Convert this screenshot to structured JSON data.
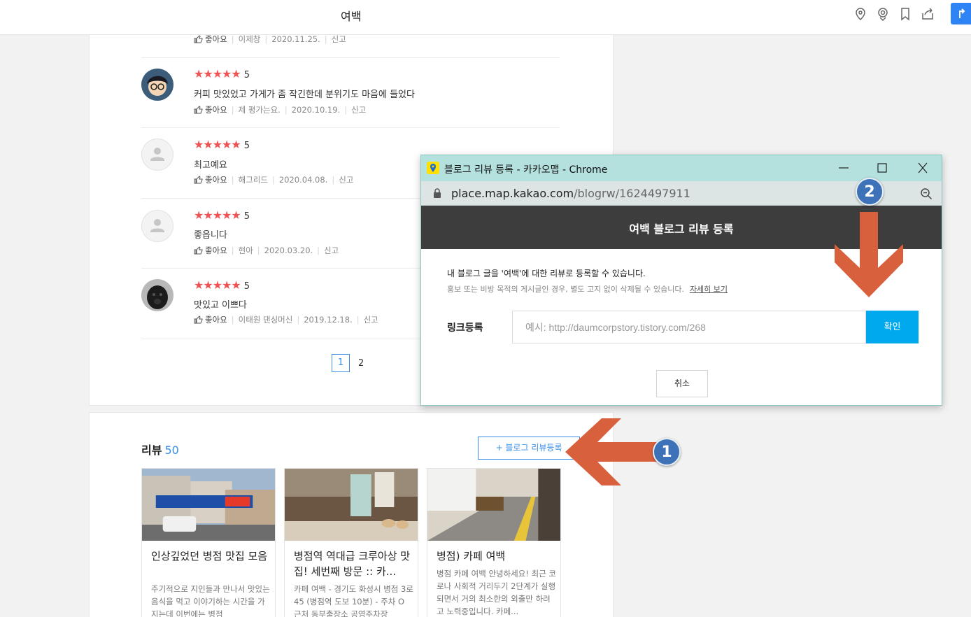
{
  "topbar": {
    "title": "여백",
    "icons": [
      "map-pin-icon",
      "target-pin-icon",
      "bookmark-icon",
      "share-icon",
      "route-icon"
    ]
  },
  "reviews": [
    {
      "stars": "★★★★★",
      "score": "",
      "text": "",
      "like": "좋아요",
      "author": "이제창",
      "date": "2020.11.25.",
      "report": "신고"
    },
    {
      "stars": "★★★★★",
      "score": "5",
      "text": "커피 맛있었고 가게가 좀 작긴한데 분위기도 마음에 들었다",
      "like": "좋아요",
      "author": "제 평가는요.",
      "date": "2020.10.19.",
      "report": "신고"
    },
    {
      "stars": "★★★★★",
      "score": "5",
      "text": "최고예요",
      "like": "좋아요",
      "author": "해그리드",
      "date": "2020.04.08.",
      "report": "신고"
    },
    {
      "stars": "★★★★★",
      "score": "5",
      "text": "좋읍니다",
      "like": "좋아요",
      "author": "현아",
      "date": "2020.03.20.",
      "report": "신고"
    },
    {
      "stars": "★★★★★",
      "score": "5",
      "text": "맛있고 이쁘다",
      "like": "좋아요",
      "author": "이태원 댄싱머신",
      "date": "2019.12.18.",
      "report": "신고"
    }
  ],
  "pagination": {
    "current": "1",
    "next": "2"
  },
  "blog_section": {
    "title": "리뷰",
    "count": "50",
    "register_button": "+ 블로그 리뷰등록",
    "cards": [
      {
        "title": "인상깊었던 병점 맛집 모음",
        "desc": "주기적으로 지인들과 만나서 맛있는 음식을 먹고 이야기하는 시간을 가지는데 이번에는 병점"
      },
      {
        "title": "병점역 역대급 크루아상 맛집! 세번째 방문 :: 카...",
        "desc": "카페 여백 - 경기도 화성시 병점 3로 45 (병점역 도보 10분) - 주차 O 근처 동부출장소 공영주차장"
      },
      {
        "title": "병점) 카페 여백",
        "desc": "병점 카페 여백 안녕하세요! 최근 코로나 사회적 거리두기 2단계가 실행되면서 거의 최소한의 외출만 하려고 노력중입니다. 카페..."
      }
    ]
  },
  "annotations": {
    "badge1": "1",
    "badge2": "2",
    "arrow_color": "#d9603d"
  },
  "popup": {
    "window_title": "블로그 리뷰 등록 - 카카오맵 - Chrome",
    "url_host": "place.map.kakao.com",
    "url_path": "/blogrw/1624497911",
    "header": "여백 블로그 리뷰 등록",
    "desc1": "내 블로그 글을 '여백'에 대한 리뷰로 등록할 수 있습니다.",
    "desc2": "홍보 또는 비방 목적의 게시글인 경우, 별도 고지 없이 삭제될 수 있습니다.",
    "more_link": "자세히 보기",
    "link_label": "링크등록",
    "link_placeholder": "예시: http://daumcorpstory.tistory.com/268",
    "confirm": "확인",
    "cancel": "취소"
  }
}
